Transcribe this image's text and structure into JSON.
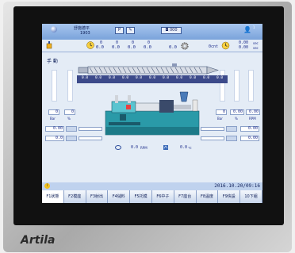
{
  "brand": "Artila",
  "header": {
    "title": "舒施德平",
    "mold_no": "1903",
    "btn_mode": "P",
    "btn_tool": "✎",
    "btn_display": "◘ 000"
  },
  "readouts": {
    "cycle_vals": [
      "0",
      "0",
      "0",
      "0"
    ],
    "cycle_decimals": [
      "0.0",
      "0.0",
      "0.0",
      "0.0"
    ],
    "shot": "0.0",
    "count": "0cnt",
    "time_top": "0.00",
    "time_bottom": "0.00",
    "unit_sec": "sec"
  },
  "mode_label": "手 動",
  "screw_values": [
    "0.0",
    "0.0",
    "0.0",
    "0.0",
    "0.0",
    "0.0",
    "0.0",
    "0.0",
    "0.0",
    "0.0",
    "0.0"
  ],
  "left_panel": {
    "val_a": "0",
    "val_b": "0",
    "unit_a": "Bar",
    "unit_b": "%",
    "row1": "0.00",
    "row2": "0.0"
  },
  "right_panel": {
    "vals": [
      "0",
      "0.00",
      "0.00"
    ],
    "units": [
      "Bar",
      "%",
      "RPM"
    ],
    "row1": "0.00",
    "row2": "0.00"
  },
  "bottom_readouts": {
    "speed": "0.0",
    "speed_unit": "RPM",
    "temp": "0.0",
    "temp_unit": "℃"
  },
  "status": {
    "datetime": "2016.10.20/09:16"
  },
  "fkeys": [
    {
      "label": "F1狀態",
      "active": true
    },
    {
      "label": "F2模座",
      "active": false
    },
    {
      "label": "F3射出",
      "active": false
    },
    {
      "label": "F4儲料",
      "active": false
    },
    {
      "label": "F5托模",
      "active": false
    },
    {
      "label": "F6中子",
      "active": false
    },
    {
      "label": "F7座台",
      "active": false
    },
    {
      "label": "F8溫度",
      "active": false
    },
    {
      "label": "F9快設",
      "active": false
    },
    {
      "label": "10下組",
      "active": false
    }
  ]
}
